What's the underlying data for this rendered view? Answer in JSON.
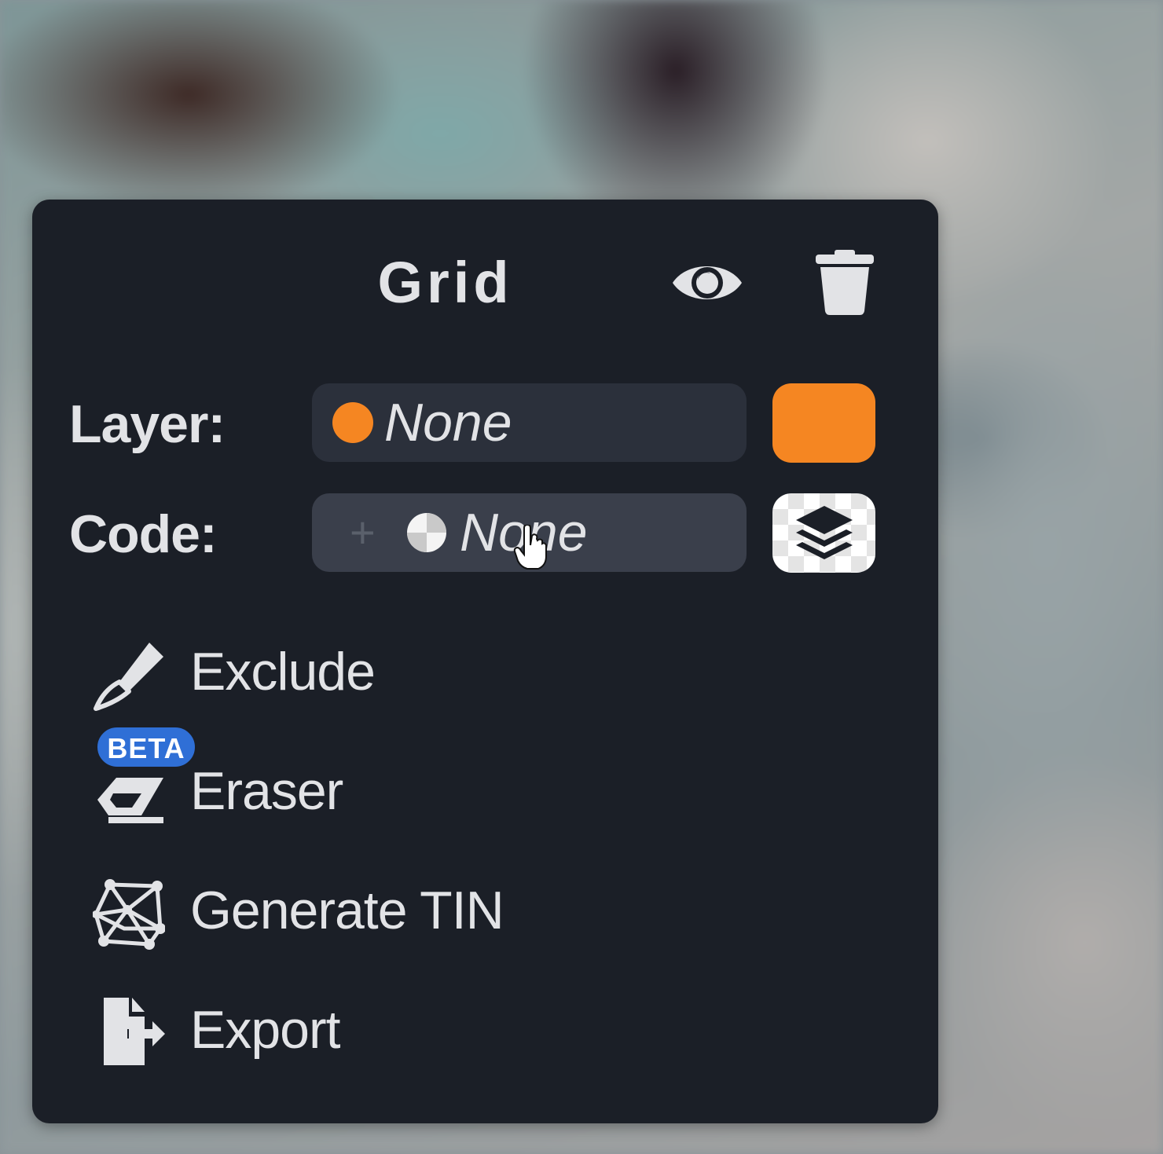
{
  "panel": {
    "title": "Grid",
    "icons": {
      "visibility": "eye-icon",
      "delete": "trash-icon"
    }
  },
  "layer": {
    "label": "Layer:",
    "value": "None",
    "dot_color": "#f58622",
    "swatch_color": "#f58622"
  },
  "code": {
    "label": "Code:",
    "value": "None",
    "plus": "+",
    "icons": {
      "code": "half-circle-icon",
      "layers": "layers-icon"
    }
  },
  "menu": {
    "items": [
      {
        "label": "Exclude",
        "icon": "scalpel-icon"
      },
      {
        "label": "Eraser",
        "icon": "eraser-icon",
        "badge": "BETA"
      },
      {
        "label": "Generate TIN",
        "icon": "tin-mesh-icon"
      },
      {
        "label": "Export",
        "icon": "file-export-icon"
      }
    ]
  },
  "colors": {
    "panel_bg": "#1b1f27",
    "accent_orange": "#f58622",
    "beta_blue": "#2f6fd6",
    "text": "#e2e3e6"
  }
}
